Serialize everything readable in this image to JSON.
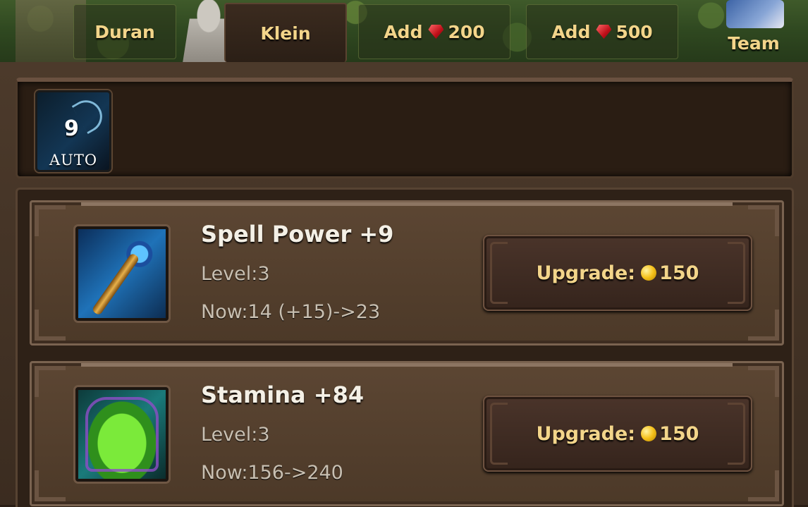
{
  "tabs": [
    {
      "label": "Duran",
      "active": false
    },
    {
      "label": "Klein",
      "active": true
    },
    {
      "label": "Add",
      "gem_amount": "200"
    },
    {
      "label": "Add",
      "gem_amount": "500"
    },
    {
      "label": "Team"
    }
  ],
  "auto": {
    "count": "9",
    "label": "AUTO"
  },
  "items": [
    {
      "name": "Spell Power +9",
      "level": "Level:3",
      "now": "Now:14 (+15)->23",
      "icon": "staff-icon",
      "button_label": "Upgrade:",
      "cost": "150"
    },
    {
      "name": "Stamina +84",
      "level": "Level:3",
      "now": "Now:156->240",
      "icon": "armor-icon",
      "button_label": "Upgrade:",
      "cost": "150"
    }
  ],
  "colors": {
    "accent_gold": "#f3d58a",
    "panel_brown": "#4c3928",
    "gem_red": "#c0101a",
    "coin_gold": "#f5c11a"
  }
}
